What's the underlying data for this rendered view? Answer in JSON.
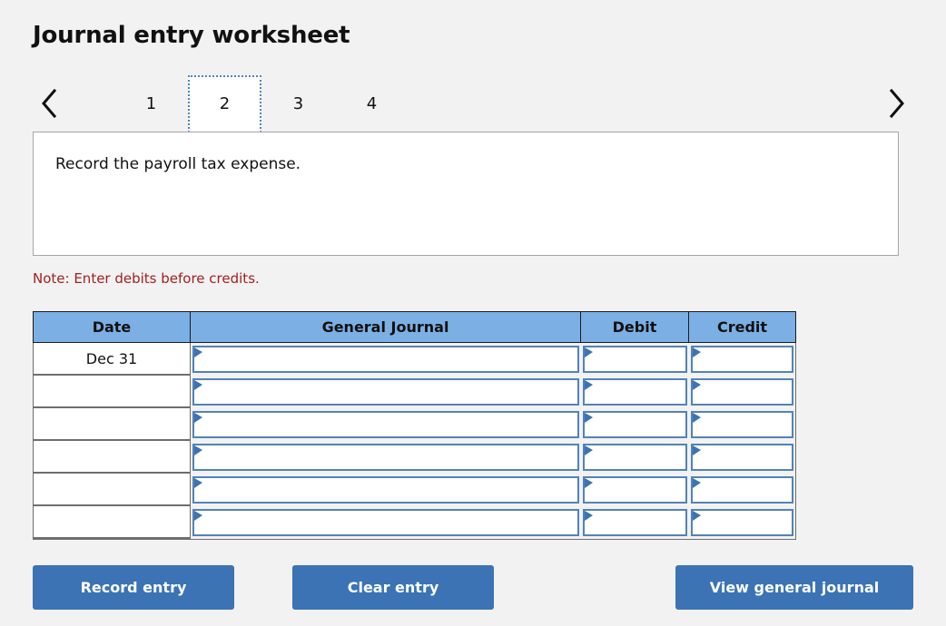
{
  "page_title": "Journal entry worksheet",
  "background_color": "#f2f2f2",
  "colors": {
    "header_blue": "#7cafe4",
    "button_blue": "#3b73b4",
    "field_border_blue": "#5283b8",
    "note_red": "#a32020"
  },
  "nav": {
    "prev_icon": "chevron-left-icon",
    "next_icon": "chevron-right-icon",
    "tabs": [
      {
        "label": "1",
        "active": false
      },
      {
        "label": "2",
        "active": true
      },
      {
        "label": "3",
        "active": false
      },
      {
        "label": "4",
        "active": false
      }
    ]
  },
  "instruction": {
    "text": "Record the payroll tax expense."
  },
  "note": "Note: Enter debits before credits.",
  "table": {
    "headers": {
      "date": "Date",
      "general_journal": "General Journal",
      "debit": "Debit",
      "credit": "Credit"
    },
    "rows": [
      {
        "date": "Dec 31",
        "general_journal": "",
        "debit": "",
        "credit": ""
      },
      {
        "date": "",
        "general_journal": "",
        "debit": "",
        "credit": ""
      },
      {
        "date": "",
        "general_journal": "",
        "debit": "",
        "credit": ""
      },
      {
        "date": "",
        "general_journal": "",
        "debit": "",
        "credit": ""
      },
      {
        "date": "",
        "general_journal": "",
        "debit": "",
        "credit": ""
      },
      {
        "date": "",
        "general_journal": "",
        "debit": "",
        "credit": ""
      }
    ]
  },
  "buttons": {
    "record": "Record entry",
    "clear": "Clear entry",
    "view": "View general journal"
  }
}
